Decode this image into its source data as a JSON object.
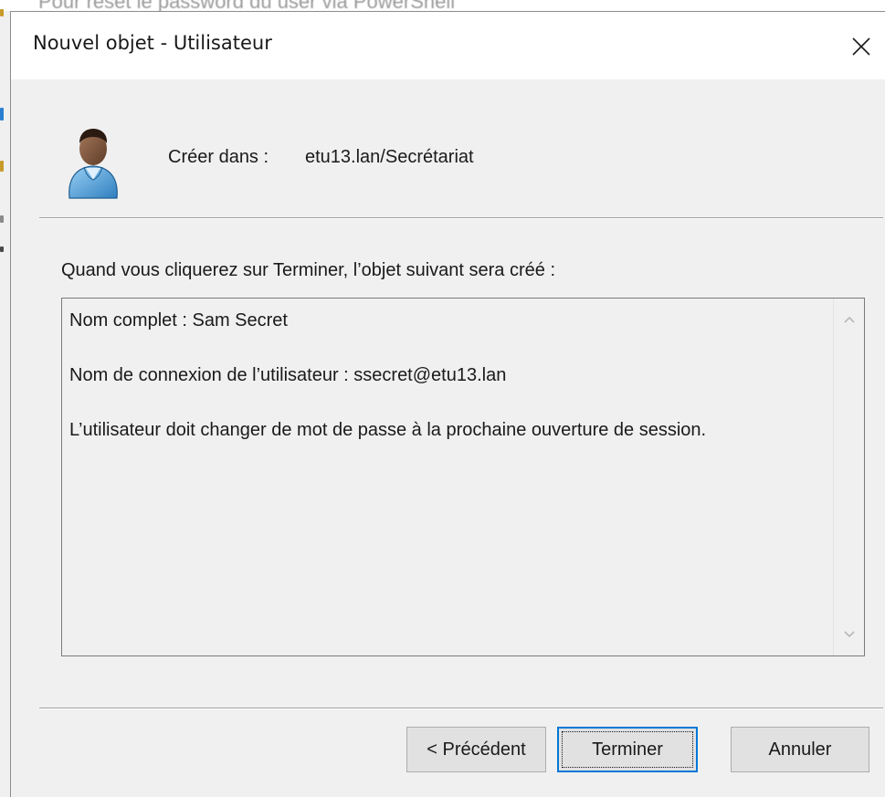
{
  "background": {
    "partial_text": "Pour reset le password du user via PowerShell"
  },
  "dialog": {
    "title": "Nouvel objet - Utilisateur",
    "close_label": "×"
  },
  "header": {
    "icon": "user-icon",
    "location_label": "Créer dans :",
    "location_value": "etu13.lan/Secrétariat"
  },
  "summary": {
    "intro": "Quand vous cliquerez sur Terminer, l’objet suivant sera créé :",
    "lines": [
      "Nom complet : Sam Secret",
      "Nom de connexion de l’utilisateur : ssecret@etu13.lan",
      "L’utilisateur doit changer de mot de passe à la prochaine ouverture de session."
    ]
  },
  "buttons": {
    "previous": "< Précédent",
    "finish": "Terminer",
    "cancel": "Annuler"
  },
  "colors": {
    "accent": "#0078d7",
    "dialog_background": "#f0f0f0",
    "titlebar_background": "#ffffff"
  }
}
